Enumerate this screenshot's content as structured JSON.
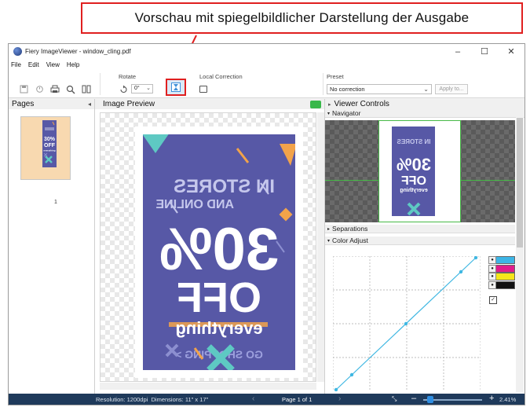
{
  "callout": {
    "text": "Vorschau mit spiegelbildlicher  Darstellung der Ausgabe",
    "border_color": "#e02020"
  },
  "window": {
    "title": "Fiery ImageViewer - window_cling.pdf",
    "controls": [
      "–",
      "☐",
      "✕"
    ]
  },
  "menu": [
    "File",
    "Edit",
    "View",
    "Help"
  ],
  "toolbar": {
    "rotate_label": "Rotate",
    "rotate_value": "0°",
    "local_correction_label": "Local Correction",
    "preset_label": "Preset",
    "preset_value": "No correction",
    "apply_label": "Apply to..."
  },
  "pages_panel": {
    "title": "Pages",
    "collapse_glyph": "◂",
    "thumb_page_number": "1",
    "thumb_text": [
      "30%",
      "OFF",
      "everything"
    ]
  },
  "preview_panel": {
    "title": "Image Preview",
    "poster": {
      "line1": "IN STORES",
      "line2": "AND ONLINE",
      "big1": "30%",
      "big2": "OFF",
      "everything": "everything",
      "cta": "GO SHOPPING >",
      "background": "#5758a6"
    }
  },
  "viewer_panel": {
    "title": "Viewer Controls",
    "navigator_label": "Navigator",
    "separations_label": "Separations",
    "color_adjust_label": "Color Adjust",
    "separation_colors": [
      "#3db5e6",
      "#e01b8c",
      "#f5e51a",
      "#111111"
    ]
  },
  "statusbar": {
    "resolution": "Resolution: 1200dpi",
    "dimensions": "Dimensions: 11\" x 17\"",
    "page": "Page 1 of 1",
    "zoom": "2.41%",
    "zoom_level": 0.12
  }
}
